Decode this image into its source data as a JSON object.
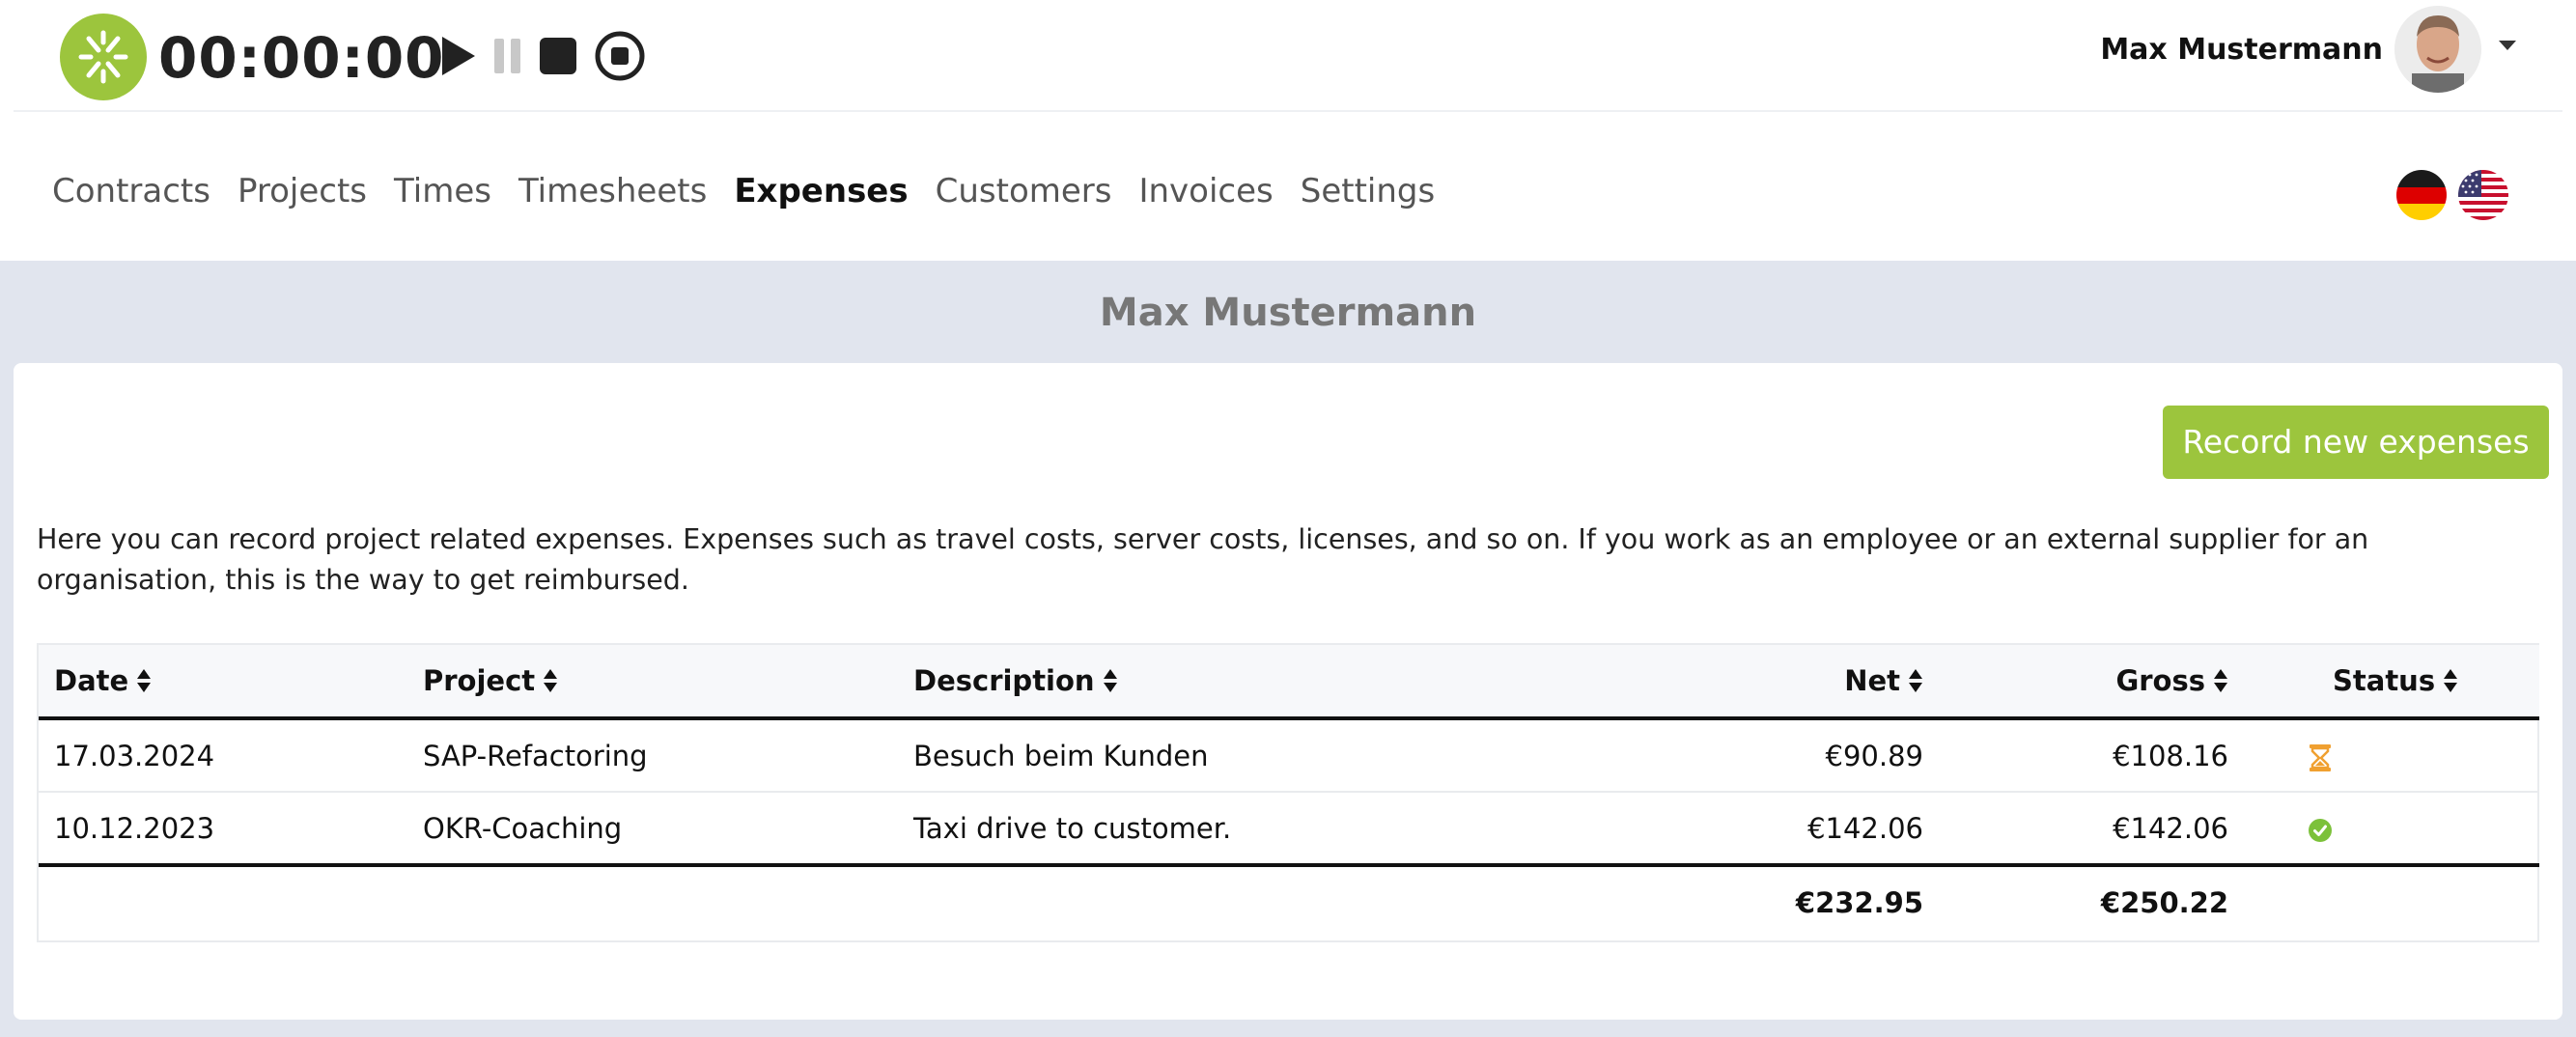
{
  "timer": {
    "display": "00:00:00",
    "play_icon": "play-icon",
    "pause_icon": "pause-icon",
    "stop_icon": "stop-icon",
    "record_icon": "record-stop-icon"
  },
  "user": {
    "name": "Max Mustermann",
    "avatar_icon": "avatar",
    "menu_icon": "caret-down-icon"
  },
  "nav": {
    "items": [
      {
        "label": "Contracts",
        "active": false
      },
      {
        "label": "Projects",
        "active": false
      },
      {
        "label": "Times",
        "active": false
      },
      {
        "label": "Timesheets",
        "active": false
      },
      {
        "label": "Expenses",
        "active": true
      },
      {
        "label": "Customers",
        "active": false
      },
      {
        "label": "Invoices",
        "active": false
      },
      {
        "label": "Settings",
        "active": false
      }
    ],
    "languages": [
      "german-flag-icon",
      "us-flag-icon"
    ]
  },
  "page": {
    "title": "Max Mustermann",
    "record_button": "Record new expenses",
    "intro": "Here you can record project related expenses. Expenses such as travel costs, server costs, licenses, and so on. If you work as an employee or an external supplier for an organisation, this is the way to get reimbursed."
  },
  "table": {
    "columns": [
      "Date",
      "Project",
      "Description",
      "Net",
      "Gross",
      "Status"
    ],
    "rows": [
      {
        "date": "17.03.2024",
        "project": "SAP-Refactoring",
        "description": "Besuch beim Kunden",
        "net": "€90.89",
        "gross": "€108.16",
        "status": "pending"
      },
      {
        "date": "10.12.2023",
        "project": "OKR-Coaching",
        "description": "Taxi drive to customer.",
        "net": "€142.06",
        "gross": "€142.06",
        "status": "approved"
      }
    ],
    "totals": {
      "net": "€232.95",
      "gross": "€250.22"
    }
  },
  "colors": {
    "brand_green": "#9cc53d",
    "pending_orange": "#f0a030",
    "approved_green": "#7cc13a",
    "background": "#e1e5ee"
  }
}
